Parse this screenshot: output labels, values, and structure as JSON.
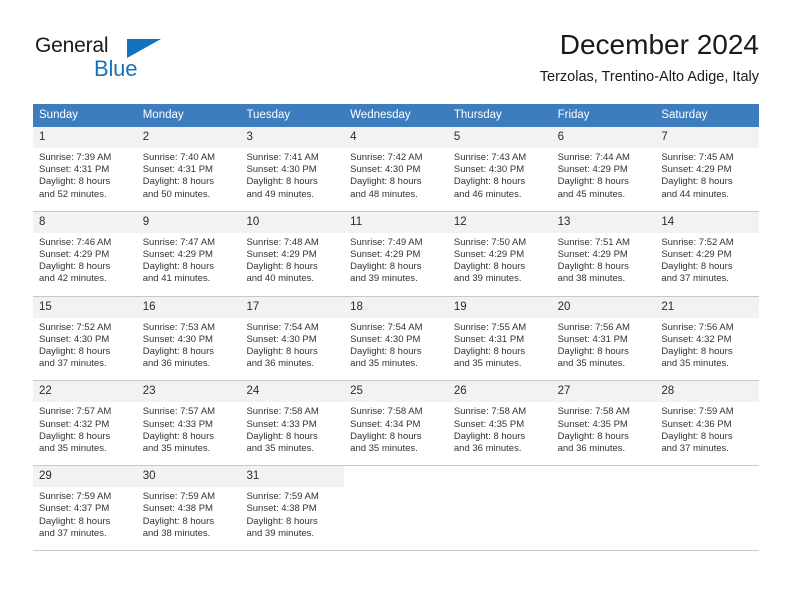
{
  "logo": {
    "word_dark": "General",
    "word_blue": "Blue",
    "triangle_icon": "blue-triangle-icon",
    "brand_color": "#1572bd"
  },
  "header": {
    "title": "December 2024",
    "subtitle": "Terzolas, Trentino-Alto Adige, Italy"
  },
  "theme": {
    "header_bg": "#3d7dbd",
    "header_text": "#ffffff",
    "daynum_bg": "#f2f2f2",
    "grid_line": "#c8c8c8",
    "body_text": "#333333"
  },
  "weekdays": [
    "Sunday",
    "Monday",
    "Tuesday",
    "Wednesday",
    "Thursday",
    "Friday",
    "Saturday"
  ],
  "weeks": [
    [
      {
        "day": "1",
        "sunrise": "Sunrise: 7:39 AM",
        "sunset": "Sunset: 4:31 PM",
        "daylight1": "Daylight: 8 hours",
        "daylight2": "and 52 minutes."
      },
      {
        "day": "2",
        "sunrise": "Sunrise: 7:40 AM",
        "sunset": "Sunset: 4:31 PM",
        "daylight1": "Daylight: 8 hours",
        "daylight2": "and 50 minutes."
      },
      {
        "day": "3",
        "sunrise": "Sunrise: 7:41 AM",
        "sunset": "Sunset: 4:30 PM",
        "daylight1": "Daylight: 8 hours",
        "daylight2": "and 49 minutes."
      },
      {
        "day": "4",
        "sunrise": "Sunrise: 7:42 AM",
        "sunset": "Sunset: 4:30 PM",
        "daylight1": "Daylight: 8 hours",
        "daylight2": "and 48 minutes."
      },
      {
        "day": "5",
        "sunrise": "Sunrise: 7:43 AM",
        "sunset": "Sunset: 4:30 PM",
        "daylight1": "Daylight: 8 hours",
        "daylight2": "and 46 minutes."
      },
      {
        "day": "6",
        "sunrise": "Sunrise: 7:44 AM",
        "sunset": "Sunset: 4:29 PM",
        "daylight1": "Daylight: 8 hours",
        "daylight2": "and 45 minutes."
      },
      {
        "day": "7",
        "sunrise": "Sunrise: 7:45 AM",
        "sunset": "Sunset: 4:29 PM",
        "daylight1": "Daylight: 8 hours",
        "daylight2": "and 44 minutes."
      }
    ],
    [
      {
        "day": "8",
        "sunrise": "Sunrise: 7:46 AM",
        "sunset": "Sunset: 4:29 PM",
        "daylight1": "Daylight: 8 hours",
        "daylight2": "and 42 minutes."
      },
      {
        "day": "9",
        "sunrise": "Sunrise: 7:47 AM",
        "sunset": "Sunset: 4:29 PM",
        "daylight1": "Daylight: 8 hours",
        "daylight2": "and 41 minutes."
      },
      {
        "day": "10",
        "sunrise": "Sunrise: 7:48 AM",
        "sunset": "Sunset: 4:29 PM",
        "daylight1": "Daylight: 8 hours",
        "daylight2": "and 40 minutes."
      },
      {
        "day": "11",
        "sunrise": "Sunrise: 7:49 AM",
        "sunset": "Sunset: 4:29 PM",
        "daylight1": "Daylight: 8 hours",
        "daylight2": "and 39 minutes."
      },
      {
        "day": "12",
        "sunrise": "Sunrise: 7:50 AM",
        "sunset": "Sunset: 4:29 PM",
        "daylight1": "Daylight: 8 hours",
        "daylight2": "and 39 minutes."
      },
      {
        "day": "13",
        "sunrise": "Sunrise: 7:51 AM",
        "sunset": "Sunset: 4:29 PM",
        "daylight1": "Daylight: 8 hours",
        "daylight2": "and 38 minutes."
      },
      {
        "day": "14",
        "sunrise": "Sunrise: 7:52 AM",
        "sunset": "Sunset: 4:29 PM",
        "daylight1": "Daylight: 8 hours",
        "daylight2": "and 37 minutes."
      }
    ],
    [
      {
        "day": "15",
        "sunrise": "Sunrise: 7:52 AM",
        "sunset": "Sunset: 4:30 PM",
        "daylight1": "Daylight: 8 hours",
        "daylight2": "and 37 minutes."
      },
      {
        "day": "16",
        "sunrise": "Sunrise: 7:53 AM",
        "sunset": "Sunset: 4:30 PM",
        "daylight1": "Daylight: 8 hours",
        "daylight2": "and 36 minutes."
      },
      {
        "day": "17",
        "sunrise": "Sunrise: 7:54 AM",
        "sunset": "Sunset: 4:30 PM",
        "daylight1": "Daylight: 8 hours",
        "daylight2": "and 36 minutes."
      },
      {
        "day": "18",
        "sunrise": "Sunrise: 7:54 AM",
        "sunset": "Sunset: 4:30 PM",
        "daylight1": "Daylight: 8 hours",
        "daylight2": "and 35 minutes."
      },
      {
        "day": "19",
        "sunrise": "Sunrise: 7:55 AM",
        "sunset": "Sunset: 4:31 PM",
        "daylight1": "Daylight: 8 hours",
        "daylight2": "and 35 minutes."
      },
      {
        "day": "20",
        "sunrise": "Sunrise: 7:56 AM",
        "sunset": "Sunset: 4:31 PM",
        "daylight1": "Daylight: 8 hours",
        "daylight2": "and 35 minutes."
      },
      {
        "day": "21",
        "sunrise": "Sunrise: 7:56 AM",
        "sunset": "Sunset: 4:32 PM",
        "daylight1": "Daylight: 8 hours",
        "daylight2": "and 35 minutes."
      }
    ],
    [
      {
        "day": "22",
        "sunrise": "Sunrise: 7:57 AM",
        "sunset": "Sunset: 4:32 PM",
        "daylight1": "Daylight: 8 hours",
        "daylight2": "and 35 minutes."
      },
      {
        "day": "23",
        "sunrise": "Sunrise: 7:57 AM",
        "sunset": "Sunset: 4:33 PM",
        "daylight1": "Daylight: 8 hours",
        "daylight2": "and 35 minutes."
      },
      {
        "day": "24",
        "sunrise": "Sunrise: 7:58 AM",
        "sunset": "Sunset: 4:33 PM",
        "daylight1": "Daylight: 8 hours",
        "daylight2": "and 35 minutes."
      },
      {
        "day": "25",
        "sunrise": "Sunrise: 7:58 AM",
        "sunset": "Sunset: 4:34 PM",
        "daylight1": "Daylight: 8 hours",
        "daylight2": "and 35 minutes."
      },
      {
        "day": "26",
        "sunrise": "Sunrise: 7:58 AM",
        "sunset": "Sunset: 4:35 PM",
        "daylight1": "Daylight: 8 hours",
        "daylight2": "and 36 minutes."
      },
      {
        "day": "27",
        "sunrise": "Sunrise: 7:58 AM",
        "sunset": "Sunset: 4:35 PM",
        "daylight1": "Daylight: 8 hours",
        "daylight2": "and 36 minutes."
      },
      {
        "day": "28",
        "sunrise": "Sunrise: 7:59 AM",
        "sunset": "Sunset: 4:36 PM",
        "daylight1": "Daylight: 8 hours",
        "daylight2": "and 37 minutes."
      }
    ],
    [
      {
        "day": "29",
        "sunrise": "Sunrise: 7:59 AM",
        "sunset": "Sunset: 4:37 PM",
        "daylight1": "Daylight: 8 hours",
        "daylight2": "and 37 minutes."
      },
      {
        "day": "30",
        "sunrise": "Sunrise: 7:59 AM",
        "sunset": "Sunset: 4:38 PM",
        "daylight1": "Daylight: 8 hours",
        "daylight2": "and 38 minutes."
      },
      {
        "day": "31",
        "sunrise": "Sunrise: 7:59 AM",
        "sunset": "Sunset: 4:38 PM",
        "daylight1": "Daylight: 8 hours",
        "daylight2": "and 39 minutes."
      },
      {
        "day": "",
        "sunrise": "",
        "sunset": "",
        "daylight1": "",
        "daylight2": ""
      },
      {
        "day": "",
        "sunrise": "",
        "sunset": "",
        "daylight1": "",
        "daylight2": ""
      },
      {
        "day": "",
        "sunrise": "",
        "sunset": "",
        "daylight1": "",
        "daylight2": ""
      },
      {
        "day": "",
        "sunrise": "",
        "sunset": "",
        "daylight1": "",
        "daylight2": ""
      }
    ]
  ]
}
